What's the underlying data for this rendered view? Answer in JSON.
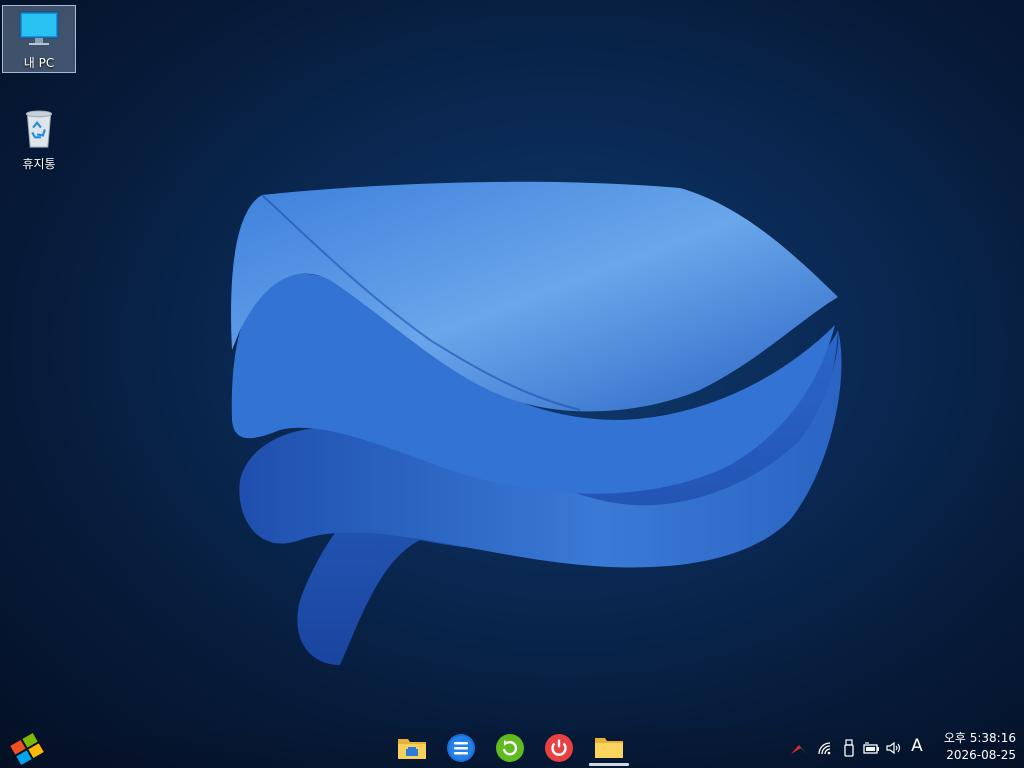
{
  "desktop": {
    "icons": [
      {
        "label": "내 PC",
        "icon": "monitor-icon",
        "selected": true
      },
      {
        "label": "휴지통",
        "icon": "recycle-bin-icon",
        "selected": false
      }
    ]
  },
  "taskbar": {
    "start_icon": "windows-flag-icon",
    "apps": [
      {
        "name": "file-explorer",
        "icon": "file-explorer-icon"
      },
      {
        "name": "menu-app",
        "icon": "menu-lines-icon"
      },
      {
        "name": "refresh-app",
        "icon": "refresh-icon"
      },
      {
        "name": "power-app",
        "icon": "power-icon"
      },
      {
        "name": "folder-app",
        "icon": "folder-icon",
        "active": true
      }
    ],
    "tray": {
      "ime_label": "A",
      "icons": [
        "network-icon",
        "wifi-icon",
        "usb-icon",
        "battery-icon",
        "volume-icon"
      ]
    },
    "clock": {
      "time": "오후 5:38:16",
      "date": "2026-08-25"
    }
  },
  "colors": {
    "accent": "#2f6fd6",
    "background": "#0a2a55"
  }
}
